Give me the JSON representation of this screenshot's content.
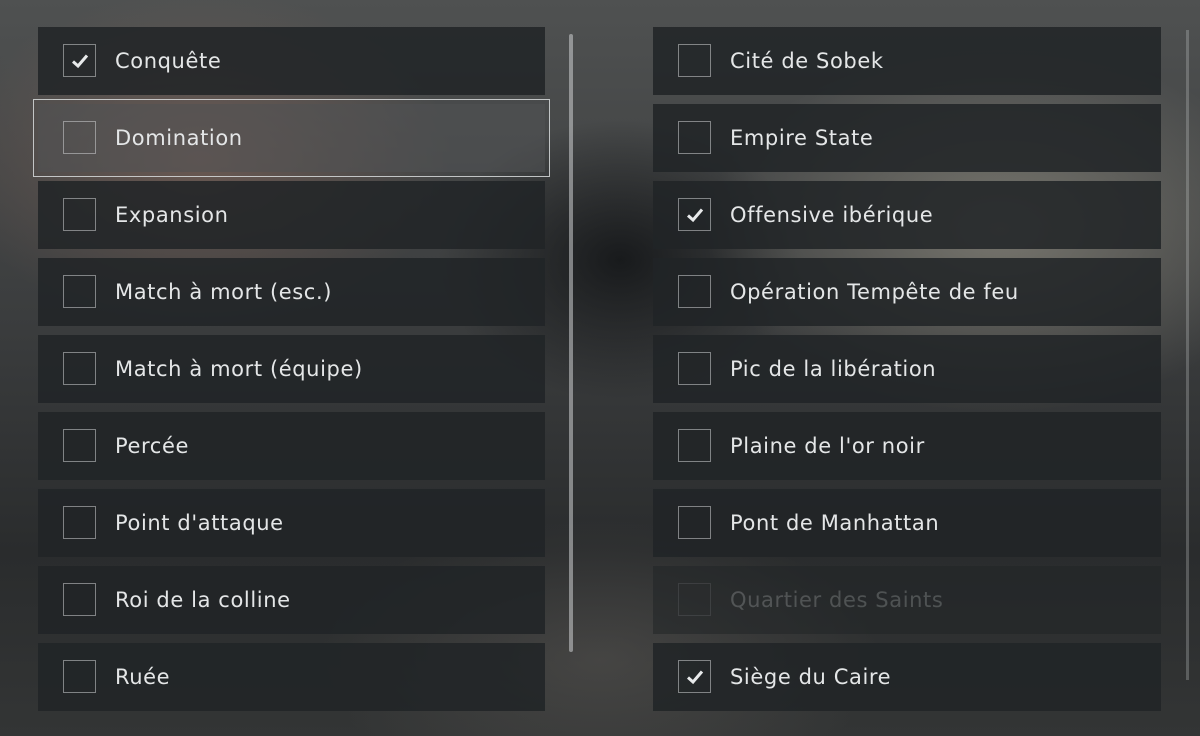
{
  "game_modes": {
    "items": [
      {
        "label": "Conquête",
        "checked": true,
        "state": "normal"
      },
      {
        "label": "Domination",
        "checked": false,
        "state": "selected"
      },
      {
        "label": "Expansion",
        "checked": false,
        "state": "normal"
      },
      {
        "label": "Match à mort (esc.)",
        "checked": false,
        "state": "normal"
      },
      {
        "label": "Match à mort (équipe)",
        "checked": false,
        "state": "normal"
      },
      {
        "label": "Percée",
        "checked": false,
        "state": "normal"
      },
      {
        "label": "Point d'attaque",
        "checked": false,
        "state": "normal"
      },
      {
        "label": "Roi de la colline",
        "checked": false,
        "state": "normal"
      },
      {
        "label": "Ruée",
        "checked": false,
        "state": "normal"
      }
    ]
  },
  "maps": {
    "items": [
      {
        "label": "Cité de Sobek",
        "checked": false,
        "state": "normal"
      },
      {
        "label": "Empire State",
        "checked": false,
        "state": "normal"
      },
      {
        "label": "Offensive ibérique",
        "checked": true,
        "state": "normal"
      },
      {
        "label": "Opération Tempête de feu",
        "checked": false,
        "state": "normal"
      },
      {
        "label": "Pic de la libération",
        "checked": false,
        "state": "normal"
      },
      {
        "label": "Plaine de l'or noir",
        "checked": false,
        "state": "normal"
      },
      {
        "label": "Pont de Manhattan",
        "checked": false,
        "state": "normal"
      },
      {
        "label": "Quartier des Saints",
        "checked": false,
        "state": "disabled"
      },
      {
        "label": "Siège du Caire",
        "checked": true,
        "state": "normal"
      }
    ]
  },
  "icons": {
    "checkbox": "checkbox-icon",
    "checkmark": "checkmark-icon"
  },
  "colors": {
    "text": "#e4e6e7",
    "row_background": "#212426",
    "focus_outline": "#d7dadc"
  }
}
